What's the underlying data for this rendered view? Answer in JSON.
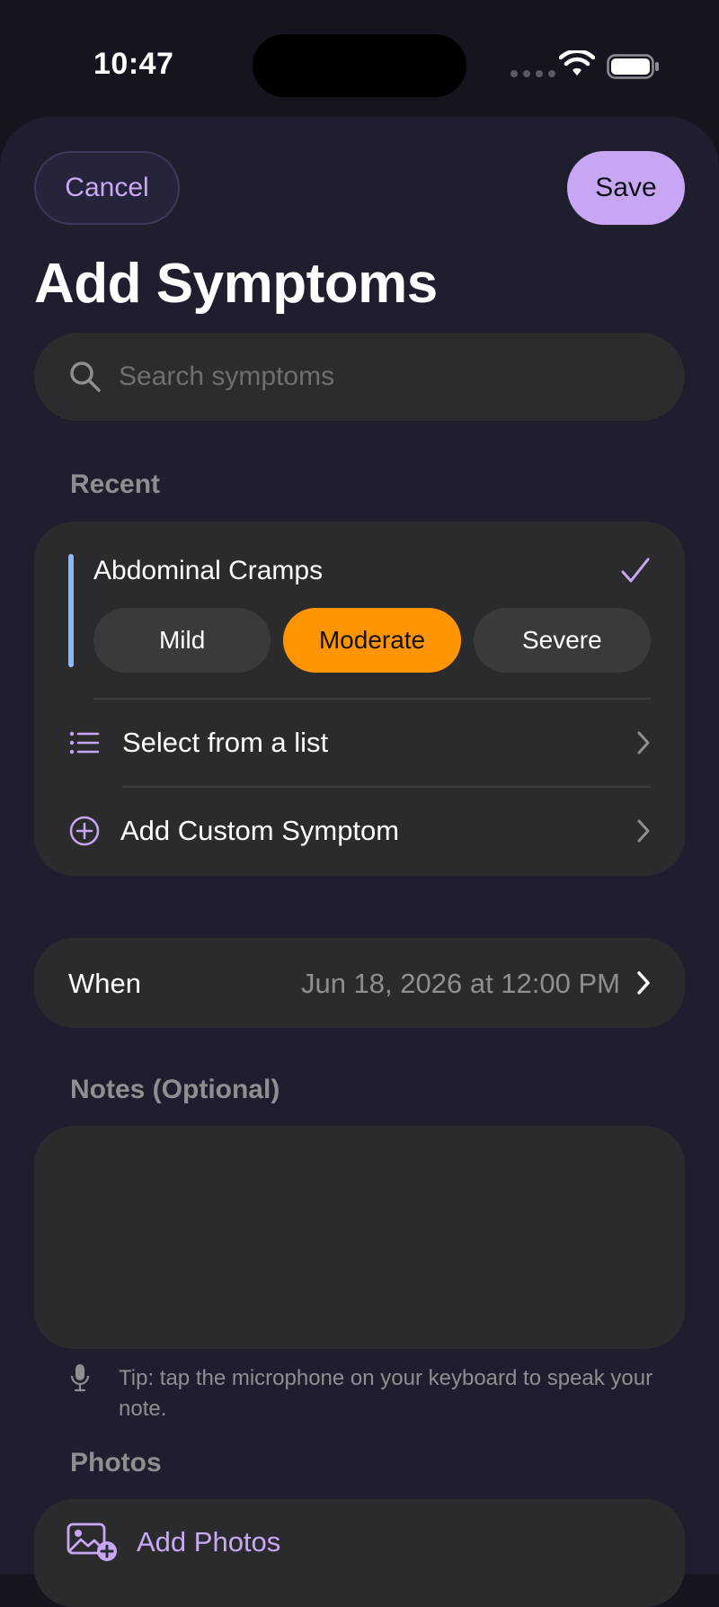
{
  "status_bar": {
    "time": "10:47"
  },
  "header": {
    "cancel_label": "Cancel",
    "save_label": "Save",
    "title": "Add Symptoms"
  },
  "search": {
    "placeholder": "Search symptoms"
  },
  "recent": {
    "section_label": "Recent",
    "symptom": "Abdominal Cramps",
    "severity_options": [
      "Mild",
      "Moderate",
      "Severe"
    ],
    "selected_severity": "Moderate",
    "select_list_label": "Select from a list",
    "add_custom_label": "Add Custom Symptom"
  },
  "when": {
    "label": "When",
    "value": "Jun 18, 2026 at 12:00 PM"
  },
  "notes": {
    "section_label": "Notes (Optional)",
    "tip": "Tip: tap the microphone on your keyboard to speak your note."
  },
  "photos": {
    "section_label": "Photos",
    "add_label": "Add Photos"
  },
  "colors": {
    "accent_purple": "#c7a7f3",
    "selected_orange": "#ff9500",
    "recent_accent_blue": "#8bb8f0",
    "sheet_background": "#1e1e2e",
    "card_background": "#2b2b2e"
  },
  "icons": {
    "search": "magnifying-glass",
    "check": "checkmark",
    "list": "list-bullet",
    "add": "plus-circle",
    "chevron": "chevron-right",
    "mic": "microphone",
    "photo": "photo-badge-plus"
  }
}
